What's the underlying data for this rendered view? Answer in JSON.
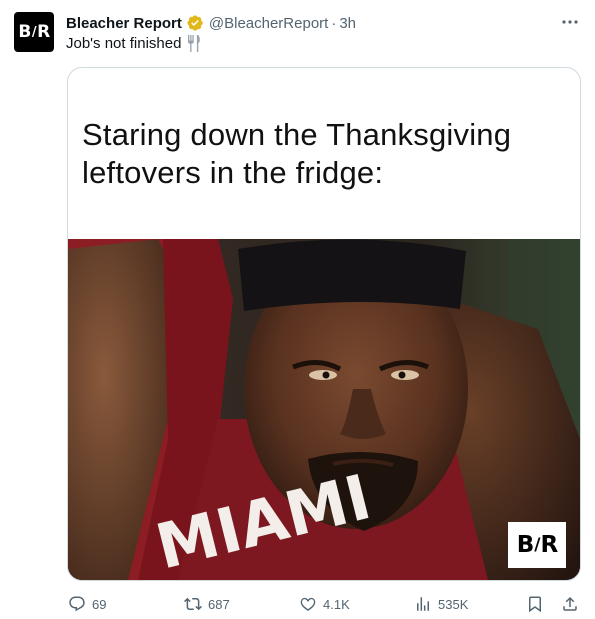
{
  "author": {
    "avatar_text_left": "B",
    "avatar_text_slash": "/",
    "avatar_text_right": "R",
    "display_name": "Bleacher Report",
    "verified_color": "#e2b719",
    "handle": "@BleacherReport",
    "separator": "·",
    "time": "3h"
  },
  "tweet": {
    "text": "Job's not finished",
    "emoji_icon": "fork-and-knife-icon"
  },
  "media": {
    "caption": "Staring down the Thanksgiving leftovers in the fridge:",
    "jersey_text": "MIAMI",
    "watermark_left": "B",
    "watermark_slash": "/",
    "watermark_right": "R"
  },
  "actions": {
    "replies": "69",
    "reposts": "687",
    "likes": "4.1K",
    "views": "535K"
  },
  "colors": {
    "text": "#0f1419",
    "secondary": "#536471",
    "border": "#cfd9de"
  }
}
